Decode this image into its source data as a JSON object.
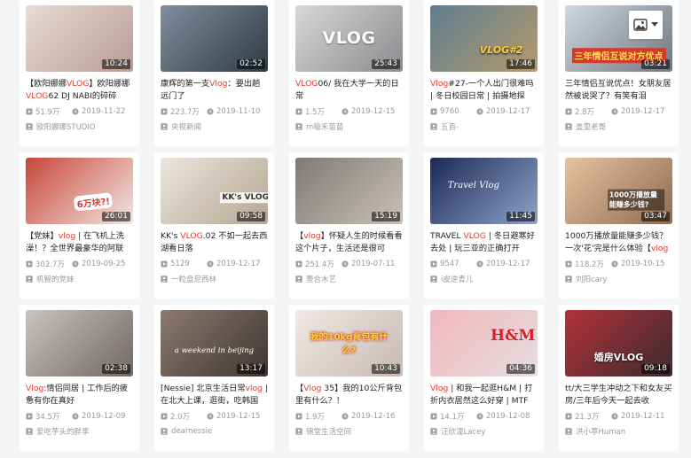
{
  "cards": [
    {
      "duration": "10:24",
      "overlay": "",
      "title": [
        "【欧阳娜娜",
        {
          "hl": "VLOG"
        },
        "】欧阳娜娜",
        {
          "hl": "VLOG"
        },
        "62 DJ NABI的碎碎"
      ],
      "views": "51.9万",
      "date": "2019-11-22",
      "author": "欧阳娜娜STUDIO",
      "bg": [
        "#e9dcd6",
        "#b79c92"
      ]
    },
    {
      "duration": "02:52",
      "overlay": "",
      "title": [
        "康辉的第一支",
        {
          "hl": "Vlog"
        },
        "：要出趟远门了"
      ],
      "views": "223.7万",
      "date": "2019-11-10",
      "author": "央视新闻",
      "bg": [
        "#7f8f9e",
        "#2f3b44"
      ]
    },
    {
      "duration": "25:43",
      "overlay": "VLOG",
      "title": [
        {
          "hl": "VLOG"
        },
        "06/ 我在大学一天的日常"
      ],
      "views": "1.5万",
      "date": "2019-12-15",
      "author": "m噫禾苗苗",
      "bg": [
        "#d8d8d6",
        "#8a8b8f"
      ]
    },
    {
      "duration": "17:46",
      "overlay": "VLOG#2",
      "title": [
        {
          "hl": "Vlog"
        },
        "#27-一个人出门很难吗 | 冬日校园日常 | 拍摄地探"
      ],
      "views": "9760",
      "date": "2019-12-17",
      "author": "五百-",
      "bg": [
        "#5f7e91",
        "#b59a6a"
      ]
    },
    {
      "duration": "03:21",
      "overlay": "三年情侣互说对方优点",
      "title": [
        "三年情侣互说优点！女朋友居然被说哭了？有笑有泪"
      ],
      "views": "2.8万",
      "date": "2019-12-17",
      "author": "盖里老哥",
      "bg": [
        "#cfd8e0",
        "#6f7880"
      ]
    },
    {
      "duration": "26:01",
      "overlay": "6万块?!",
      "title": [
        "【党妹】",
        {
          "hl": "vlog"
        },
        " | 在飞机上洗澡！？全世界最豪华的阿联"
      ],
      "views": "302.7万",
      "date": "2019-09-25",
      "author": "机智的党妹",
      "bg": [
        "#c8463a",
        "#f1e7e2"
      ]
    },
    {
      "duration": "09:58",
      "overlay": "KK's VLOG",
      "title": [
        "KK's ",
        {
          "hl": "VLOG"
        },
        ".02 不如一起去西湖看日落"
      ],
      "views": "5129",
      "date": "2019-12-17",
      "author": "一粒盘尼西林",
      "bg": [
        "#ece6dc",
        "#b5a692"
      ]
    },
    {
      "duration": "15:19",
      "overlay": "",
      "title": [
        "【",
        {
          "hl": "vlog"
        },
        "】怀疑人生的时候看看这个片子，生活还是很可"
      ],
      "views": "251.4万",
      "date": "2019-07-11",
      "author": "壹合木艺",
      "bg": [
        "#7d7a77",
        "#c9c1b6"
      ]
    },
    {
      "duration": "11:45",
      "overlay": "Travel Vlog",
      "title": [
        "TRAVEL ",
        {
          "hl": "VLOG"
        },
        " | 冬日避寒好去处 | 玩三亚的正确打开"
      ],
      "views": "9547",
      "date": "2019-12-17",
      "author": "i皮逆青儿",
      "bg": [
        "#1c2a55",
        "#8fa4c9"
      ]
    },
    {
      "duration": "03:47",
      "overlay": "1000万播放量能赚多少钱?",
      "title": [
        "1000万播放量能赚多少钱？一次'花'完是什么体验【",
        {
          "hl": "vlog"
        }
      ],
      "views": "118.2万",
      "date": "2019-10-15",
      "author": "刘阳cary",
      "bg": [
        "#e7c3a0",
        "#8e6b52"
      ]
    },
    {
      "duration": "02:38",
      "overlay": "",
      "title": [
        {
          "hl": "Vlog"
        },
        ":情侣同居 | 工作后的疲惫有你在真好"
      ],
      "views": "34.5万",
      "date": "2019-12-09",
      "author": "爱吃芋头的胖李",
      "bg": [
        "#c9c4c2",
        "#6f6762"
      ]
    },
    {
      "duration": "13:17",
      "overlay": "a weekend in beijing",
      "title": [
        "[Nessie] 北京生活日常",
        {
          "hl": "vlog"
        },
        " | 在北大上课，逛街，吃韩国"
      ],
      "views": "2.0万",
      "date": "2019-12-15",
      "author": "dearnessie",
      "bg": [
        "#8d7a70",
        "#3e3533"
      ]
    },
    {
      "duration": "10:43",
      "overlay": "我的10kg背包有什么?",
      "title": [
        "【",
        {
          "hl": "Vlog"
        },
        " 35】我的10公斤背包里有什么？！"
      ],
      "views": "1.9万",
      "date": "2019-12-16",
      "author": "锦堂生活空间",
      "bg": [
        "#f0e9e5",
        "#c7b9b3"
      ]
    },
    {
      "duration": "04:36",
      "overlay": "H&M",
      "title": [
        {
          "hl": "Vlog"
        },
        " | 和我一起逛H&M | 打折内衣居然这么好穿 | MTF"
      ],
      "views": "14.1万",
      "date": "2019-12-08",
      "author": "汪欣潼Lacey",
      "bg": [
        "#f2b8be",
        "#e4dde0"
      ]
    },
    {
      "duration": "09:18",
      "overlay": "婚房VLOG",
      "title": [
        "tt/大三学生冲动之下和女友买房/三年后今天一起去收"
      ],
      "views": "21.3万",
      "date": "2019-12-11",
      "author": "洪小葶Human",
      "bg": [
        "#b3323a",
        "#3a2b2f"
      ]
    }
  ]
}
